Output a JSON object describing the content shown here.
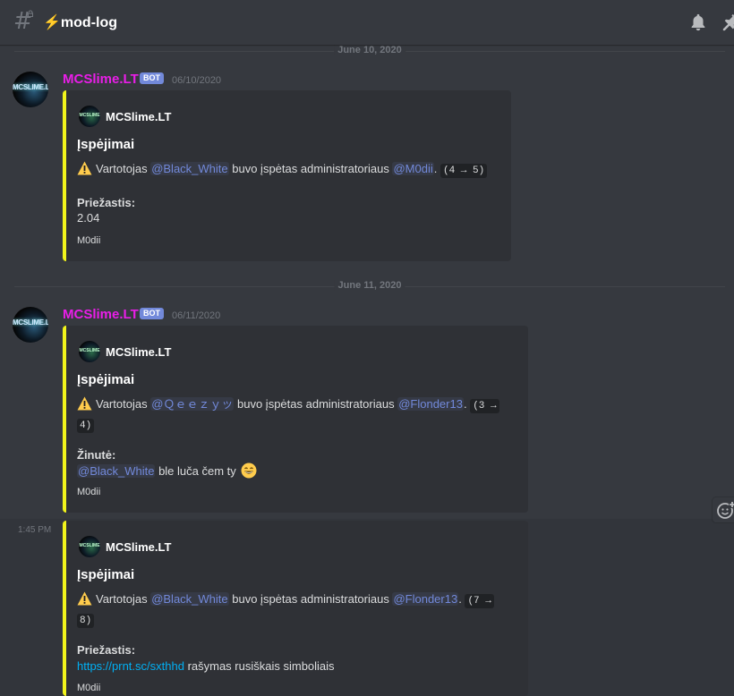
{
  "channel": {
    "name": "mod-log",
    "prefix_emoji": "⚡"
  },
  "dividers": [
    "June 10, 2020",
    "June 11, 2020"
  ],
  "messages": [
    {
      "username": "MCSlime.LT",
      "bot_tag": "BOT",
      "timestamp": "06/10/2020",
      "avatar_text": "MCSLIME.LT",
      "embed": {
        "author": "MCSlime.LT",
        "author_icon_text": "MCSLIME",
        "title": "Įspėjimai",
        "desc_prefix": "Vartotojas ",
        "user_mention": "@Black_White",
        "desc_mid": " buvo įspėtas administratoriaus ",
        "admin_mention": "@M0dii",
        "desc_after": ".",
        "code": "(4 → 5)",
        "field_name": "Priežastis:",
        "field_value": "2.04",
        "footer": "M0dii"
      }
    },
    {
      "username": "MCSlime.LT",
      "bot_tag": "BOT",
      "timestamp": "06/11/2020",
      "avatar_text": "MCSLIME.LT",
      "embed": {
        "author": "MCSlime.LT",
        "author_icon_text": "MCSLIME",
        "title": "Įspėjimai",
        "desc_prefix": "Vartotojas ",
        "user_mention": "@Ｑｅｅｚｙッ",
        "desc_mid": " buvo įspėtas administratoriaus ",
        "admin_mention": "@Flonder13",
        "desc_after": ".",
        "code_line1": "(3 →",
        "code_line2": "4)",
        "field_name": "Žinutė:",
        "field_mention": "@Black_White",
        "field_value_rest": " ble luča čem ty",
        "footer": "M0dii"
      }
    },
    {
      "side_time": "1:45 PM",
      "embed": {
        "author": "MCSlime.LT",
        "author_icon_text": "MCSLIME",
        "title": "Įspėjimai",
        "desc_prefix": "Vartotojas ",
        "user_mention": "@Black_White",
        "desc_mid": " buvo įspėtas administratoriaus ",
        "admin_mention": "@Flonder13",
        "desc_after": ".",
        "code_line1": "(7 →",
        "code_line2": "8)",
        "field_name": "Priežastis:",
        "field_link": "https://prnt.sc/sxthhd",
        "field_value_rest": " rašymas rusiškais simboliais",
        "footer": "M0dii"
      }
    }
  ],
  "icons": {
    "hash": "hash-icon",
    "bell": "bell-icon",
    "pin": "pin-icon",
    "warning": "warning-emoji",
    "smile": "grinning-emoji",
    "add_reaction": "add-reaction-icon"
  },
  "colors": {
    "background": "#36393f",
    "embed_bg": "#2f3136",
    "embed_border": "#f1f41b",
    "username": "#e91ee8",
    "bot_tag": "#7289da",
    "mention": "#7289da",
    "link": "#00b0f4"
  }
}
